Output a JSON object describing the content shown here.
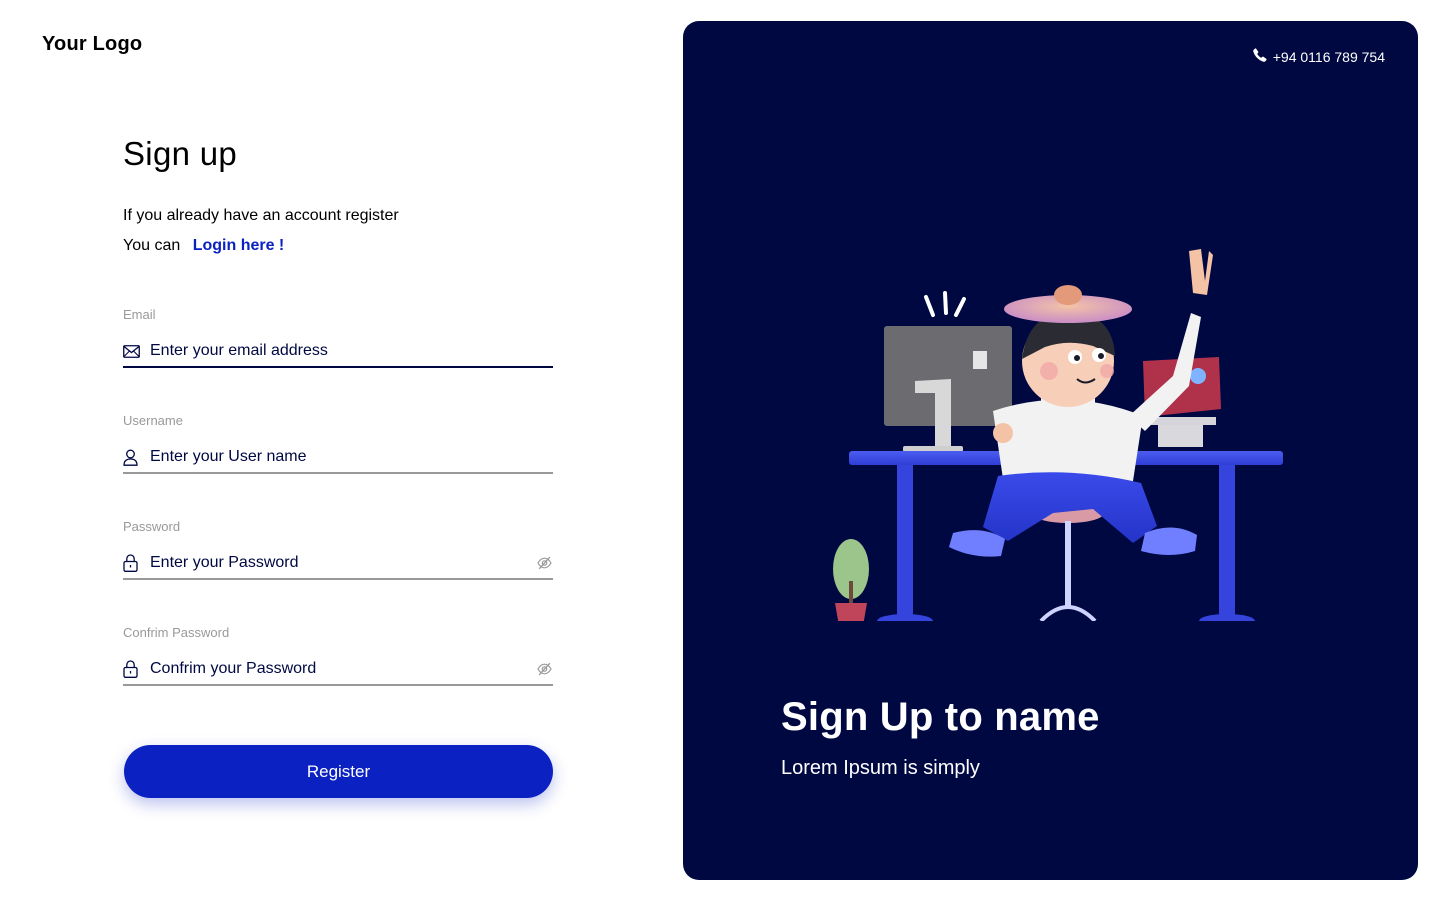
{
  "brand": {
    "logo_text": "Your Logo"
  },
  "signup": {
    "title": "Sign up",
    "intro_line1": "If you already have an account register",
    "intro_line2": "You can",
    "login_link": "Login here !"
  },
  "fields": {
    "email": {
      "label": "Email",
      "placeholder": "Enter your email address",
      "icon": "mail-icon"
    },
    "username": {
      "label": "Username",
      "placeholder": "Enter your User name",
      "icon": "user-icon"
    },
    "password": {
      "label": "Password",
      "placeholder": "Enter your Password",
      "icon": "lock-icon",
      "toggle_icon": "eye-off-icon"
    },
    "confirm_password": {
      "label": "Confrim Password",
      "placeholder": "Confrim your Password",
      "icon": "lock-icon",
      "toggle_icon": "eye-off-icon"
    }
  },
  "register_button": "Register",
  "panel": {
    "phone": "+94 0116 789 754",
    "phone_icon": "phone-icon",
    "title": "Sign Up to name",
    "subtitle": "Lorem Ipsum is simply"
  },
  "colors": {
    "accent": "#0c21c1",
    "panel_bg": "#000842",
    "input_text": "#000842",
    "muted": "#999999"
  }
}
